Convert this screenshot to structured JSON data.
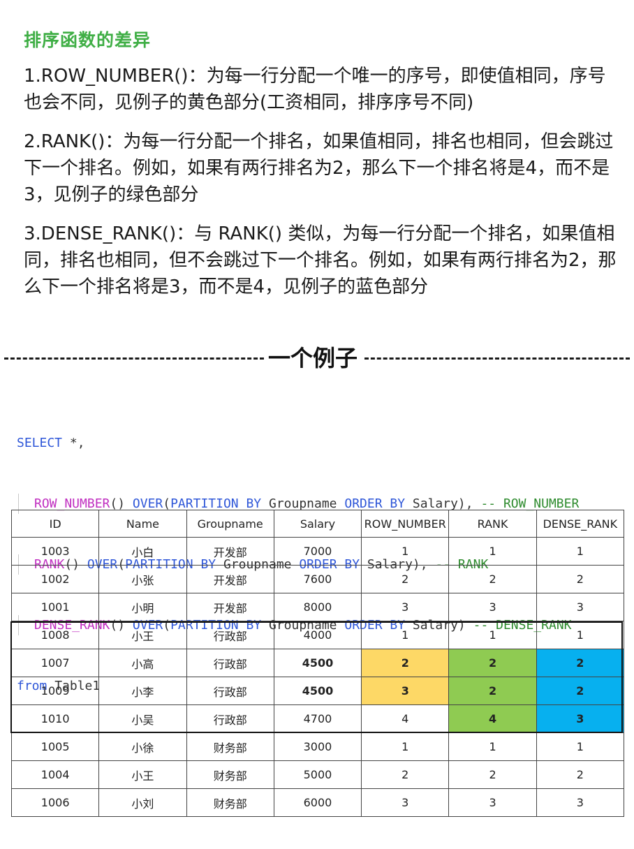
{
  "title": "排序函数的差异",
  "paragraphs": [
    "1.ROW_NUMBER()：为每一行分配一个唯一的序号，即使值相同，序号也会不同，见例子的黄色部分(工资相同，排序序号不同)",
    "2.RANK()：为每一行分配一个排名，如果值相同，排名也相同，但会跳过下一个排名。例如，如果有两行排名为2，那么下一个排名将是4，而不是3，见例子的绿色部分",
    "3.DENSE_RANK()：与 RANK() 类似，为每一行分配一个排名，如果值相同，排名也相同，但不会跳过下一个排名。例如，如果有两行排名为2，那么下一个排名将是3，而不是4，见例子的蓝色部分"
  ],
  "divider_label": "一个例子",
  "code": {
    "line1": {
      "kw": "SELECT",
      "rest": " *,"
    },
    "line2": {
      "fn": "ROW_NUMBER",
      "p1": "() ",
      "kw1": "OVER",
      "p2": "(",
      "kw2": "PARTITION BY",
      "p3": " Groupname ",
      "kw3": "ORDER BY",
      "p4": " Salary), ",
      "cm": "-- ROW_NUMBER"
    },
    "line3": {
      "fn": "RANK",
      "p1": "() ",
      "kw1": "OVER",
      "p2": "(",
      "kw2": "PARTITION BY",
      "p3": " Groupname ",
      "kw3": "ORDER BY",
      "p4": " Salary), ",
      "cm": "-- RANK"
    },
    "line4": {
      "fn": "DENSE_RANK",
      "p1": "() ",
      "kw1": "OVER",
      "p2": "(",
      "kw2": "PARTITION BY",
      "p3": " Groupname ",
      "kw3": "ORDER BY",
      "p4": " Salary) ",
      "cm": "-- DENSE_RANK"
    },
    "line5": {
      "kw": "from",
      "rest": " Table1"
    }
  },
  "table": {
    "headers": [
      "ID",
      "Name",
      "Groupname",
      "Salary",
      "ROW_NUMBER",
      "RANK",
      "DENSE_RANK"
    ],
    "rows": [
      [
        "1003",
        "小白",
        "开发部",
        "7000",
        "1",
        "1",
        "1"
      ],
      [
        "1002",
        "小张",
        "开发部",
        "7600",
        "2",
        "2",
        "2"
      ],
      [
        "1001",
        "小明",
        "开发部",
        "8000",
        "3",
        "3",
        "3"
      ],
      [
        "1008",
        "小王",
        "行政部",
        "4000",
        "1",
        "1",
        "1"
      ],
      [
        "1007",
        "小高",
        "行政部",
        "4500",
        "2",
        "2",
        "2"
      ],
      [
        "1009",
        "小李",
        "行政部",
        "4500",
        "3",
        "2",
        "2"
      ],
      [
        "1010",
        "小吴",
        "行政部",
        "4700",
        "4",
        "4",
        "3"
      ],
      [
        "1005",
        "小徐",
        "财务部",
        "3000",
        "1",
        "1",
        "1"
      ],
      [
        "1004",
        "小王",
        "财务部",
        "5000",
        "2",
        "2",
        "2"
      ],
      [
        "1006",
        "小刘",
        "财务部",
        "6000",
        "3",
        "3",
        "3"
      ]
    ],
    "highlight_colors": {
      "row_number": "#fdd866",
      "rank": "#8fcb52",
      "dense_rank": "#07b0ef"
    }
  }
}
